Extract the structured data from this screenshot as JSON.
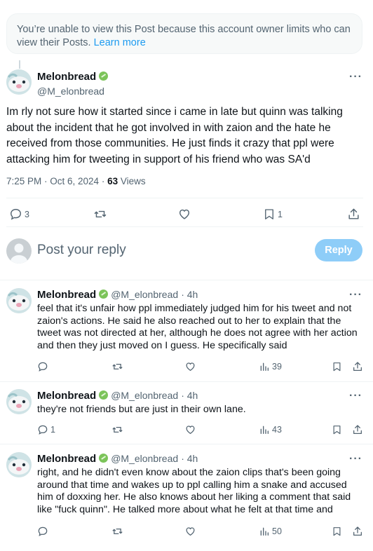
{
  "notice": {
    "text": "You’re unable to view this Post because this account owner limits who can view their Posts.",
    "link": "Learn more"
  },
  "main_post": {
    "author_name": "Melonbread",
    "handle": "@M_elonbread",
    "text": "Im rly not sure how it started since i came in late but quinn was talking about the incident that he got involved in with zaion and the hate he received from those communities. He just finds it crazy that ppl were attacking him for tweeting in support of his friend who was SA'd",
    "timestamp": "7:25 PM · Oct 6, 2024 · ",
    "views_count": "63",
    "views_label": " Views",
    "replies": "3",
    "bookmarks": "1"
  },
  "reply_composer": {
    "placeholder": "Post your reply",
    "button": "Reply"
  },
  "replies": [
    {
      "author_name": "Melonbread",
      "handle": "@M_elonbread",
      "time": "· 4h",
      "text": "feel that it's unfair how ppl immediately judged him for his tweet and not zaion's actions. He said he also reached out to her to explain that the tweet was not directed at her, although he does not agree with her action and then they just moved on I guess. He specifically said",
      "replies": "",
      "views": "39"
    },
    {
      "author_name": "Melonbread",
      "handle": "@M_elonbread",
      "time": "· 4h",
      "text": "they're not friends but are just in their own lane.",
      "replies": "1",
      "views": "43"
    },
    {
      "author_name": "Melonbread",
      "handle": "@M_elonbread",
      "time": "· 4h",
      "text": "right, and he didn't even know about the zaion clips that's been going around that time and wakes up to ppl calling him a snake and accused him of doxxing her. He also knows about her liking a comment that said like \"fuck quinn\". He talked more about what he felt at that time and",
      "replies": "",
      "views": "50"
    }
  ],
  "colors": {
    "accent": "#1d9bf0",
    "muted": "#536471",
    "reply_button": "#8ecdf8",
    "verified_leaf": "#7cc45a"
  },
  "icons": [
    "reply-icon",
    "repost-icon",
    "like-icon",
    "bookmark-icon",
    "share-icon",
    "views-icon",
    "more-icon",
    "leaf-badge-icon"
  ]
}
